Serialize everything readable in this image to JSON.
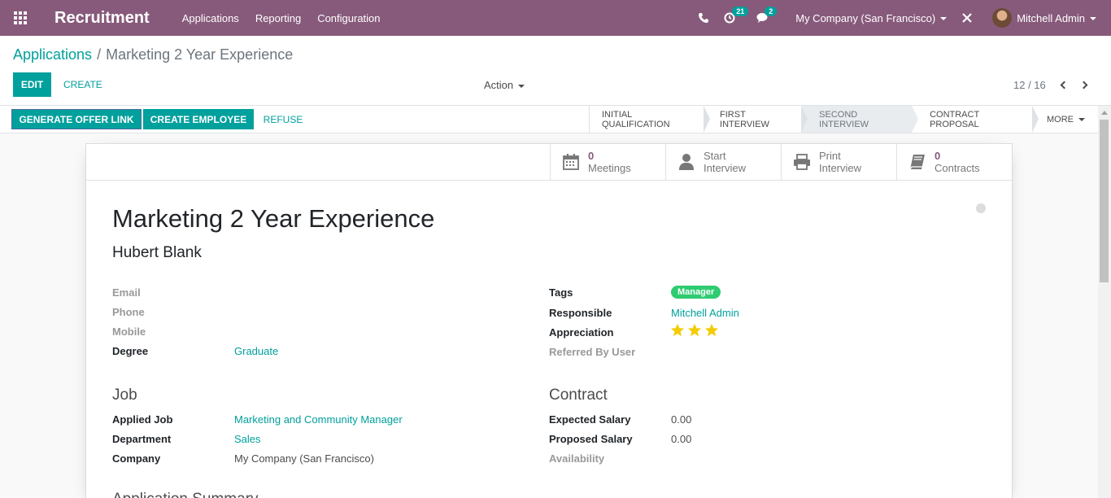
{
  "navbar": {
    "app_name": "Recruitment",
    "menu": [
      "Applications",
      "Reporting",
      "Configuration"
    ],
    "activity_count": "21",
    "message_count": "2",
    "company": "My Company (San Francisco)",
    "user": "Mitchell Admin"
  },
  "breadcrumb": {
    "parent": "Applications",
    "separator": "/",
    "current": "Marketing 2 Year Experience"
  },
  "control": {
    "edit_label": "EDIT",
    "create_label": "CREATE",
    "action_label": "Action",
    "pager": "12 / 16"
  },
  "statusbar": {
    "buttons": [
      "GENERATE OFFER LINK",
      "CREATE EMPLOYEE",
      "REFUSE"
    ],
    "stages": [
      "INITIAL QUALIFICATION",
      "FIRST INTERVIEW",
      "SECOND INTERVIEW",
      "CONTRACT PROPOSAL"
    ],
    "active_stage": "SECOND INTERVIEW",
    "more_label": "MORE"
  },
  "stat_buttons": {
    "meetings": {
      "value": "0",
      "label": "Meetings"
    },
    "start_interview": {
      "line1": "Start",
      "line2": "Interview"
    },
    "print_interview": {
      "line1": "Print",
      "line2": "Interview"
    },
    "contracts": {
      "value": "0",
      "label": "Contracts"
    }
  },
  "form": {
    "title": "Marketing 2 Year Experience",
    "partner_name": "Hubert Blank",
    "left_fields": {
      "email_label": "Email",
      "phone_label": "Phone",
      "mobile_label": "Mobile",
      "degree_label": "Degree",
      "degree_value": "Graduate"
    },
    "right_fields": {
      "tags_label": "Tags",
      "tag_value": "Manager",
      "responsible_label": "Responsible",
      "responsible_value": "Mitchell Admin",
      "appreciation_label": "Appreciation",
      "appreciation_stars": 3,
      "referred_label": "Referred By User"
    },
    "job_section": {
      "title": "Job",
      "applied_job_label": "Applied Job",
      "applied_job_value": "Marketing and Community Manager",
      "department_label": "Department",
      "department_value": "Sales",
      "company_label": "Company",
      "company_value": "My Company (San Francisco)"
    },
    "contract_section": {
      "title": "Contract",
      "expected_label": "Expected Salary",
      "expected_value": "0.00",
      "proposed_label": "Proposed Salary",
      "proposed_value": "0.00",
      "availability_label": "Availability"
    },
    "next_section_title": "Application Summary"
  },
  "colors": {
    "brand": "#875a7b",
    "accent": "#00a09d",
    "tag": "#2ecc71",
    "star": "#f3cc00"
  }
}
